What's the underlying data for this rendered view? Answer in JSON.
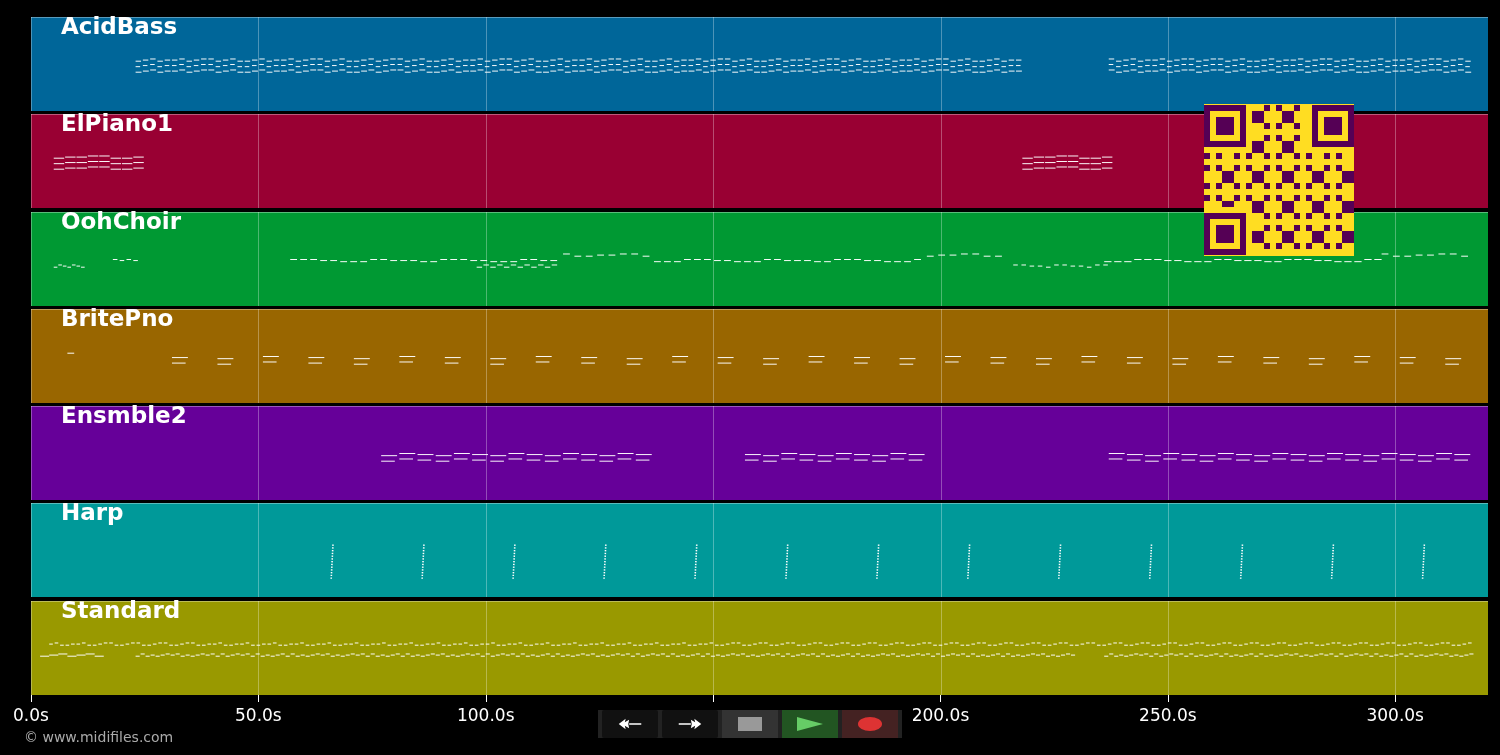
{
  "tracks": [
    {
      "name": "AcidBass",
      "color": "#006699"
    },
    {
      "name": "ElPiano1",
      "color": "#990033"
    },
    {
      "name": "OohChoir",
      "color": "#009933"
    },
    {
      "name": "BritePno",
      "color": "#996600"
    },
    {
      "name": "Ensmble2",
      "color": "#660099"
    },
    {
      "name": "Harp",
      "color": "#009999"
    },
    {
      "name": "Standard",
      "color": "#999900"
    }
  ],
  "time_axis": {
    "ticks": [
      {
        "kind": "labeled",
        "label": "0.0s"
      },
      {
        "kind": "labeled",
        "label": "50.0s"
      },
      {
        "kind": "labeled",
        "label": "100.0s"
      },
      {
        "kind": "plain"
      },
      {
        "kind": "labeled",
        "label": "200.0s"
      },
      {
        "kind": "labeled",
        "label": "250.0s"
      },
      {
        "kind": "labeled",
        "label": "300.0s"
      }
    ]
  },
  "transport": [
    {
      "kind": "rewind"
    },
    {
      "kind": "fast_forward"
    },
    {
      "kind": "stop"
    },
    {
      "kind": "play"
    },
    {
      "kind": "record"
    }
  ],
  "credit": "© www.midifiles.com"
}
